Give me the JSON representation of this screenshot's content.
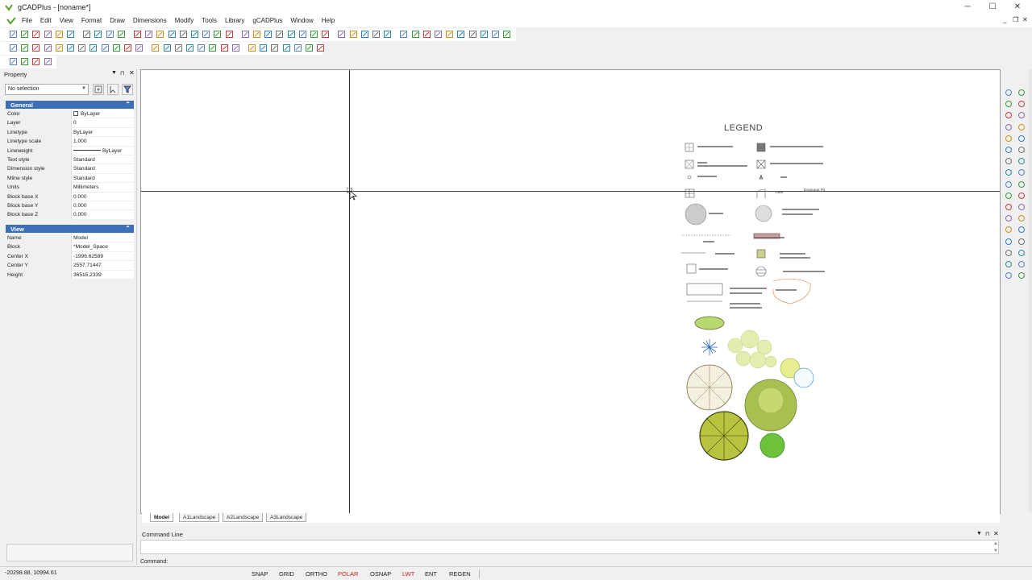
{
  "window": {
    "title": "gCADPlus - [noname*]",
    "controls": [
      "─",
      "☐",
      "✕"
    ],
    "mdi_controls": [
      "_",
      "❐",
      "✕"
    ]
  },
  "menu": [
    "File",
    "Edit",
    "View",
    "Format",
    "Draw",
    "Dimensions",
    "Modify",
    "Tools",
    "Library",
    "gCADPlus",
    "Window",
    "Help"
  ],
  "property_panel": {
    "header": "Property",
    "selection": "No selection",
    "general_title": "General",
    "general": [
      {
        "key": "Color",
        "value": "ByLayer"
      },
      {
        "key": "Layer",
        "value": "0"
      },
      {
        "key": "Linetype",
        "value": "ByLayer"
      },
      {
        "key": "Linetype scale",
        "value": "1.000"
      },
      {
        "key": "Lineweight",
        "value": "ByLayer"
      },
      {
        "key": "Text style",
        "value": "Standard"
      },
      {
        "key": "Dimension style",
        "value": "Standard"
      },
      {
        "key": "Mline style",
        "value": "Standard"
      },
      {
        "key": "Units",
        "value": "Millimeters"
      },
      {
        "key": "Block base X",
        "value": "0.000"
      },
      {
        "key": "Block base Y",
        "value": "0.000"
      },
      {
        "key": "Block base Z",
        "value": "0.000"
      }
    ],
    "view_title": "View",
    "view": [
      {
        "key": "Name",
        "value": "Model"
      },
      {
        "key": "Block",
        "value": "*Model_Space"
      },
      {
        "key": "Center X",
        "value": "-1996.62589"
      },
      {
        "key": "Center Y",
        "value": "2557.71447"
      },
      {
        "key": "Height",
        "value": "36515.2339"
      }
    ]
  },
  "legend": {
    "title": "LEGEND",
    "labels": {
      "drainage_pit": "Drainage Pit",
      "gate": "Gate"
    }
  },
  "tabs": [
    "Model",
    "A1Landscape",
    "A2Landscape",
    "A3Landscape"
  ],
  "command": {
    "title": "Command Line",
    "prompt": "Command:"
  },
  "status": {
    "coords": "-20298.88, 10994.61",
    "buttons": [
      {
        "label": "SNAP",
        "on": false
      },
      {
        "label": "GRID",
        "on": false
      },
      {
        "label": "ORTHO",
        "on": false
      },
      {
        "label": "POLAR",
        "on": true
      },
      {
        "label": "OSNAP",
        "on": false
      },
      {
        "label": "LWT",
        "on": true
      },
      {
        "label": "ENT",
        "on": false
      },
      {
        "label": "REGEN",
        "on": false
      }
    ]
  },
  "colors": {
    "section_header": "#3d6fb6",
    "accent_red": "#d02020",
    "tree_light_green": "#c8dc6a",
    "tree_olive": "#9ab43c",
    "tree_bright_green": "#6cc23a"
  }
}
